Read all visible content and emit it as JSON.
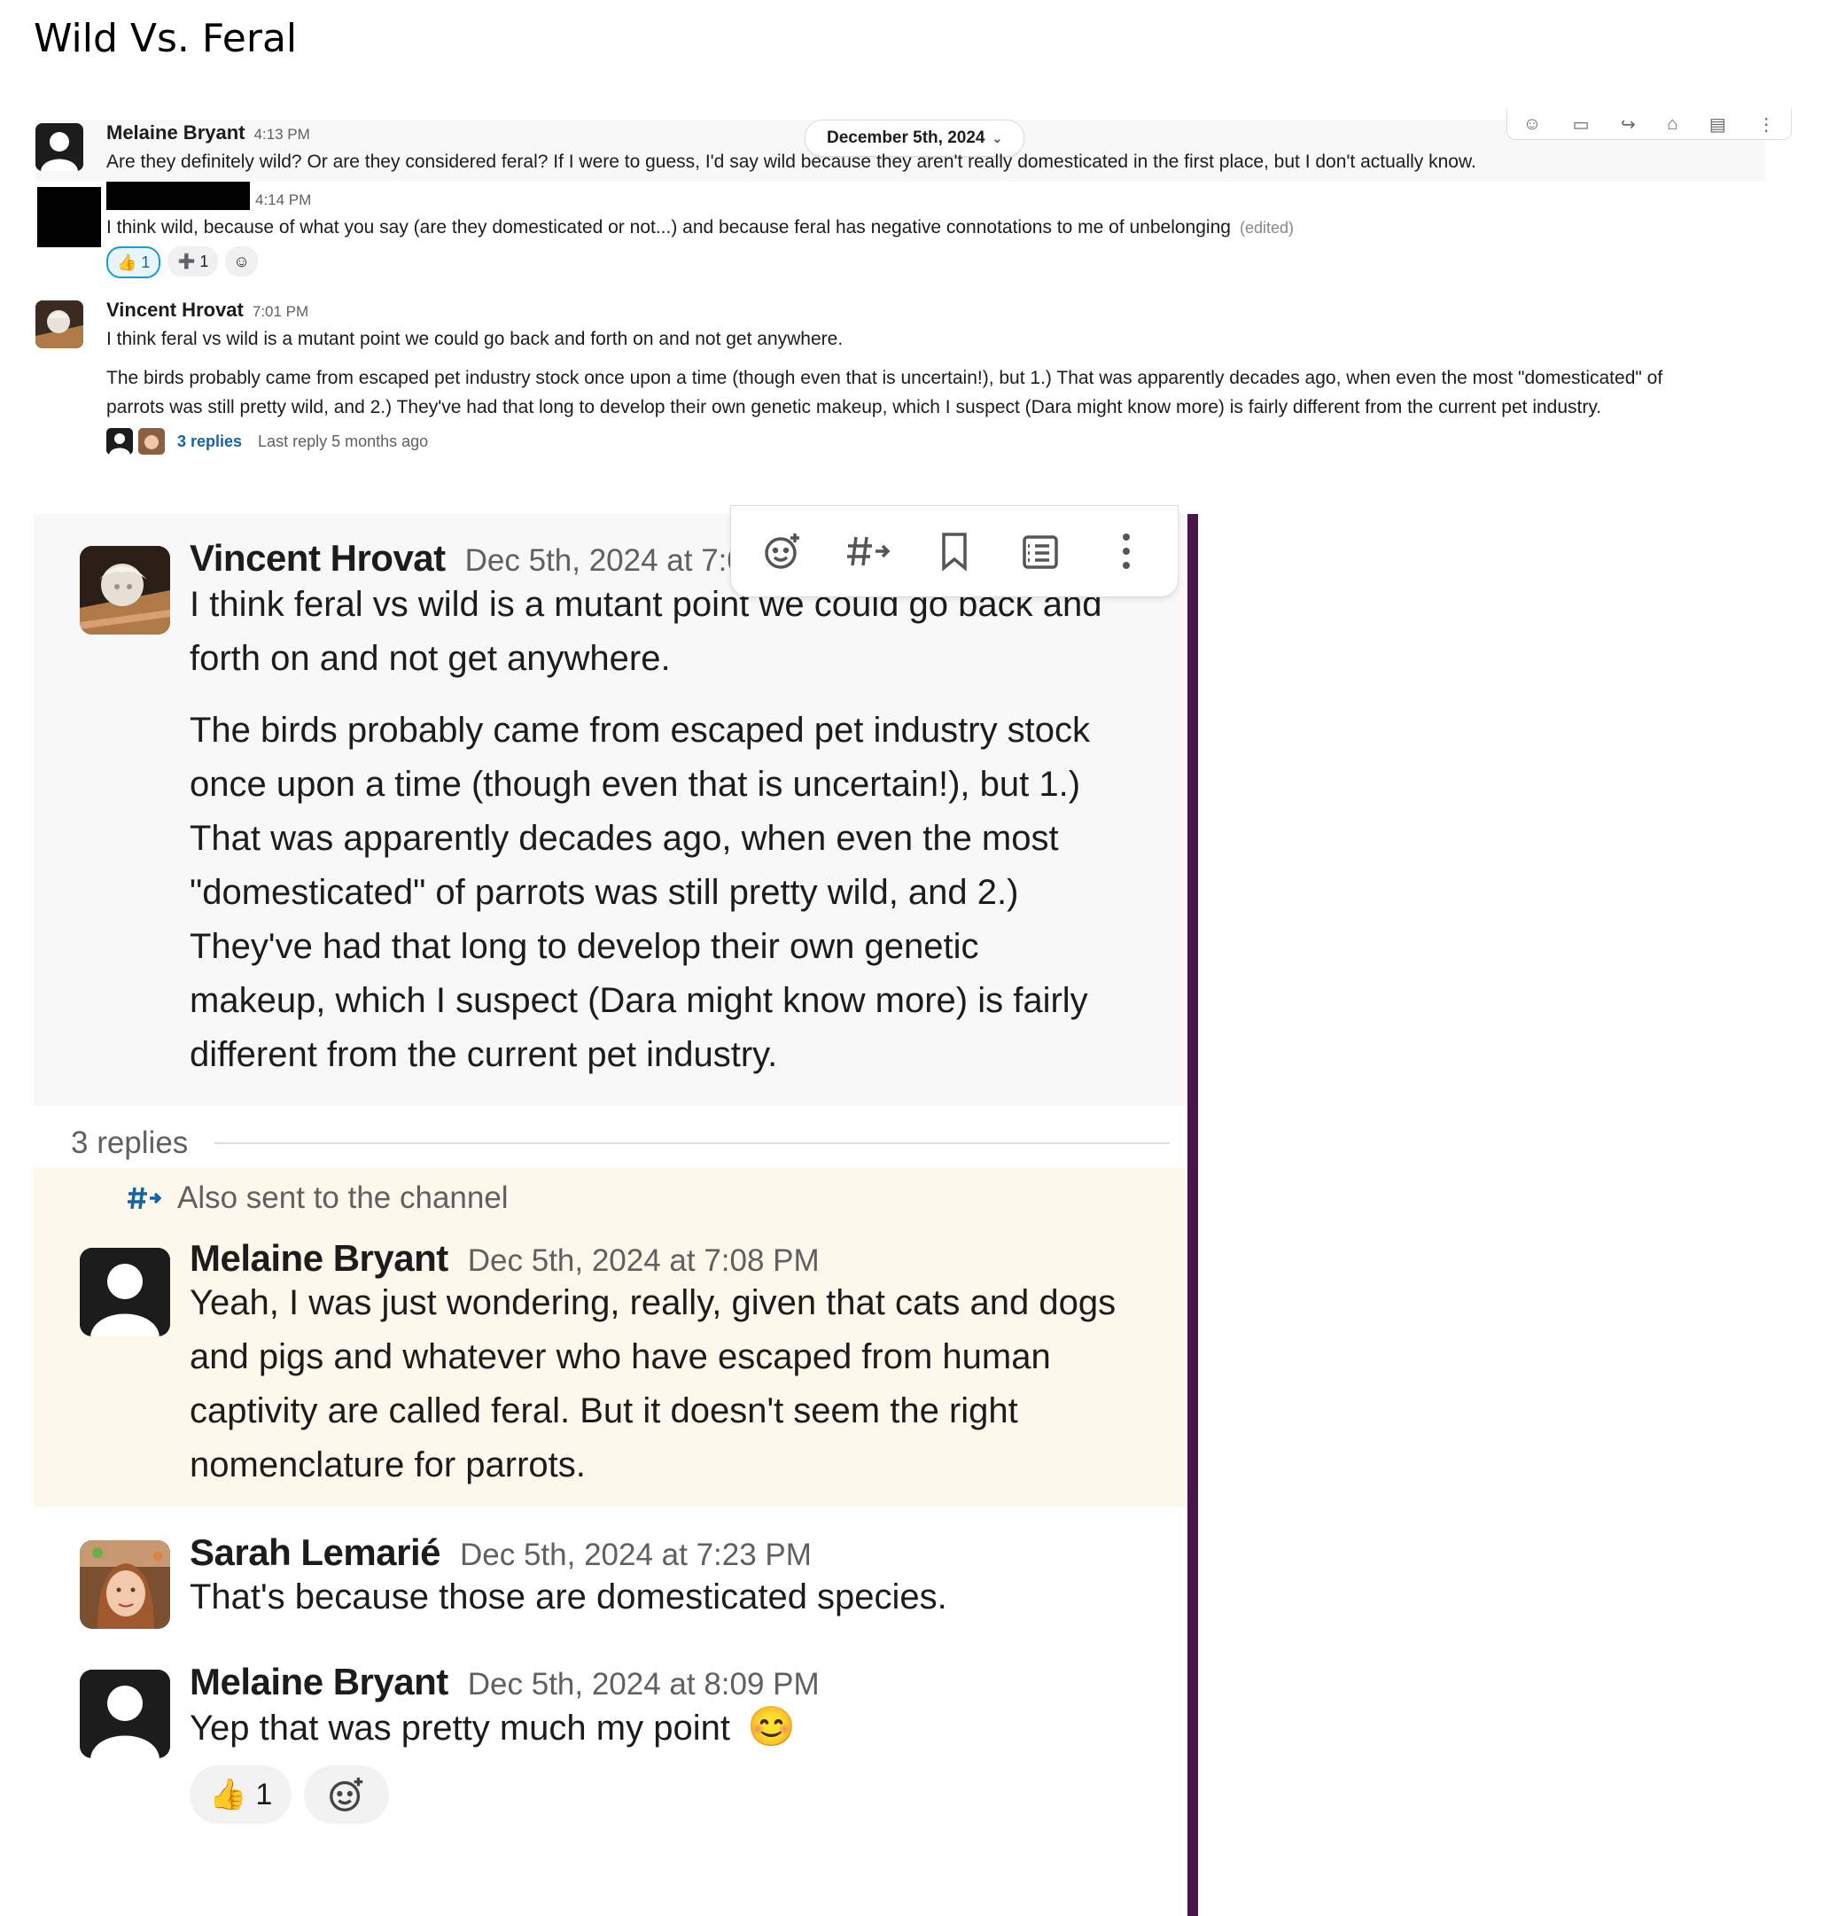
{
  "doc_title": "Wild Vs. Feral",
  "small": {
    "date_divider": "December 5th, 2024",
    "messages": [
      {
        "author": "Melaine Bryant",
        "time": "4:13 PM",
        "text": "Are they definitely wild? Or are they considered feral? If I were to guess, I'd say wild because they aren't really domesticated in the first place, but I don't actually know."
      },
      {
        "author": "",
        "time": "4:14 PM",
        "text": "I think wild, because of what you say (are they domesticated or not...) and because feral has negative connotations to me of unbelonging",
        "edited": "(edited)"
      },
      {
        "author": "Vincent Hrovat",
        "time": "7:01 PM",
        "text": "I think feral vs wild is a mutant point we could go back and forth on and not get anywhere.",
        "text2_line1": "The birds probably came from escaped pet industry stock once upon a time (though even that is uncertain!), but 1.) That was apparently decades ago, when even the most \"domesticated\" of",
        "text2_line2": "parrots was still pretty wild, and 2.) They've had that long to develop their own genetic makeup, which I suspect (Dara might know more) is fairly different from the current pet industry."
      }
    ],
    "reactions": [
      {
        "emoji": "👍",
        "count": "1"
      },
      {
        "emoji": "➕",
        "count": "1"
      }
    ],
    "thread": {
      "replies": "3 replies",
      "last_reply": "Last reply 5 months ago"
    }
  },
  "thread_panel": {
    "parent": {
      "author": "Vincent Hrovat",
      "timestamp": "Dec 5th, 2024 at 7:0",
      "para1_lines": [
        "I think feral vs wild is a mutant point we could go back and",
        "forth on and not get anywhere."
      ],
      "para2_lines": [
        "The birds probably came from escaped pet industry stock",
        "once upon a time (though even that is uncertain!), but 1.)",
        "That was apparently decades ago, when even the most",
        "\"domesticated\" of parrots was still pretty wild, and 2.)",
        "They've had that long to develop their own genetic",
        "makeup, which I suspect (Dara might know more) is fairly",
        "different from the current pet industry."
      ]
    },
    "replies_label": "3 replies",
    "also_sent": "Also sent to the channel",
    "replies": [
      {
        "author": "Melaine Bryant",
        "timestamp": "Dec 5th, 2024 at 7:08 PM",
        "lines": [
          "Yeah, I was just wondering, really, given that cats and dogs",
          "and pigs and whatever who have escaped from human",
          "captivity are called feral. But it doesn't seem the right",
          "nomenclature for parrots."
        ]
      },
      {
        "author": "Sarah Lemarié",
        "timestamp": "Dec 5th, 2024 at 7:23 PM",
        "lines": [
          "That's because those are domesticated species."
        ]
      },
      {
        "author": "Melaine Bryant",
        "timestamp": "Dec 5th, 2024 at 8:09 PM",
        "lines": [
          "Yep that was pretty much my point"
        ],
        "emoji": "😊"
      }
    ],
    "reaction": {
      "emoji": "👍",
      "count": "1"
    }
  },
  "colors": {
    "rail": "#4a154b",
    "highlight": "#fdf8ec",
    "link": "#1264a3",
    "muted": "#616061"
  }
}
